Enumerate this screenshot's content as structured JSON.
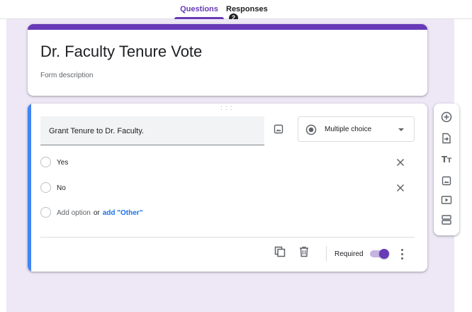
{
  "tabs": {
    "questions": "Questions",
    "responses": "Responses",
    "responses_count": "2"
  },
  "form": {
    "title": "Dr. Faculty Tenure Vote",
    "description_placeholder": "Form description"
  },
  "question": {
    "text": "Grant Tenure to Dr. Faculty.",
    "type": "Multiple choice",
    "options": [
      "Yes",
      "No"
    ],
    "add_option": "Add option",
    "or": "or",
    "add_other": "add \"Other\"",
    "required_label": "Required",
    "required": true
  },
  "toolbar_icons": [
    "add-question-icon",
    "import-questions-icon",
    "add-title-icon",
    "add-image-icon",
    "add-video-icon",
    "add-section-icon"
  ],
  "colors": {
    "accent": "#673ab7",
    "background": "#ede7f6",
    "active_card": "#4285f4",
    "link": "#1a73e8"
  }
}
